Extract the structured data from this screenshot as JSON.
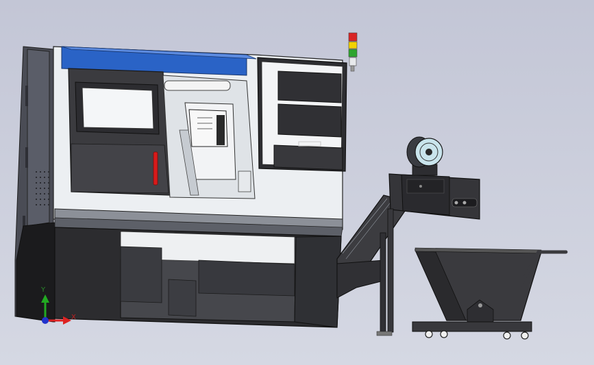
{
  "viewport": {
    "background_top": "#c3c6d6",
    "background_bottom": "#d5d8e3"
  },
  "triad": {
    "y_label": "Y",
    "x_label": "X",
    "y_color": "#22aa22",
    "x_color": "#dd2222",
    "z_color": "#2233cc"
  },
  "colors": {
    "machine_blue": "#2a63c6",
    "body_light": "#eceff2",
    "dark_gray": "#3a3a3a",
    "handle_red": "#d81b1b",
    "light_green": "#2ea52e",
    "light_yellow": "#f2d200",
    "light_red": "#d92525",
    "motor_cyan": "#c9e4ec"
  },
  "components": [
    "cnc-lathe-enclosure",
    "signal-tower-light",
    "control-panel",
    "chip-conveyor",
    "conveyor-motor",
    "chip-cart"
  ]
}
